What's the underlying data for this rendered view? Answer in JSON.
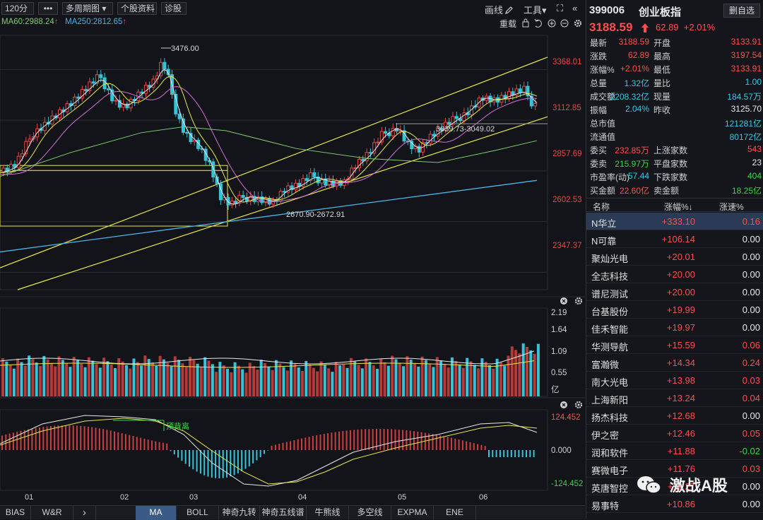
{
  "toolbar": {
    "period": "120分",
    "more": "•••",
    "multi": "多周期图",
    "dropdown": "▾",
    "info": "个股资料",
    "diag": "诊股",
    "draw": "画线",
    "tools": "工具",
    "tools_arrow": "▾",
    "expand": "⛶",
    "collapse": "«",
    "overlay": "重载"
  },
  "ma": {
    "ma60": "MA60:2988.24",
    "ma250": "MA250:2812.65",
    "arrow": "↑"
  },
  "chart_data": {
    "type": "candlestick",
    "price_axis": [
      "3368.01",
      "3112.85",
      "2857.69",
      "2602.53",
      "2347.37"
    ],
    "annotations": {
      "high": "3476.00",
      "low_zone": "2670.90-2672.91",
      "mid_zone": "3039.73-3049.02"
    },
    "volume_axis": [
      "2.19",
      "1.64",
      "1.09",
      "0.55",
      "亿"
    ],
    "macd_axis": [
      "124.452",
      "0.000",
      "-124.452"
    ],
    "macd_label": "顶背离",
    "months": [
      "01",
      "02",
      "03",
      "04",
      "05",
      "06"
    ]
  },
  "icons": {
    "lock": "lock-icon",
    "undo": "undo-icon",
    "plus": "plus-icon",
    "minus": "minus-icon",
    "gear": "gear-icon",
    "close": "close-icon"
  },
  "bottom_tabs": [
    "BIAS",
    "W&R",
    "›",
    "MA",
    "BOLL",
    "神奇九转",
    "神奇五线谱",
    "牛熊线",
    "多空线",
    "EXPMA",
    "ENE"
  ],
  "quote": {
    "code": "399006",
    "name": "创业板指",
    "remove": "删自选",
    "price": "3188.59",
    "change": "62.89",
    "pct": "+2.01%",
    "rows": [
      [
        "最新",
        "3188.59",
        "red",
        "开盘",
        "3133.91",
        "red"
      ],
      [
        "涨跌",
        "62.89",
        "red",
        "最高",
        "3197.54",
        "red"
      ],
      [
        "涨幅%",
        "+2.01%",
        "red",
        "最低",
        "3133.91",
        "red"
      ],
      [
        "总量",
        "1.32亿",
        "cyan",
        "量比",
        "1.00",
        "cyan"
      ],
      [
        "成交额",
        "2208.32亿",
        "cyan",
        "现量",
        "184.57万",
        "cyan"
      ],
      [
        "振幅",
        "2.04%",
        "cyan",
        "昨收",
        "3125.70",
        "white"
      ],
      [
        "总市值",
        "",
        "white",
        "",
        "121281亿",
        "cyan"
      ],
      [
        "流通值",
        "",
        "white",
        "",
        "80172亿",
        "cyan"
      ],
      [
        "委买",
        "232.85万",
        "red",
        "上涨家数",
        "543",
        "red"
      ],
      [
        "委卖",
        "215.97万",
        "green",
        "平盘家数",
        "23",
        "white"
      ],
      [
        "市盈率(动)",
        "57.44",
        "cyan",
        "下跌家数",
        "404",
        "green"
      ],
      [
        "买金额",
        "22.60亿",
        "red",
        "卖金额",
        "18.25亿",
        "green"
      ]
    ]
  },
  "list": {
    "headers": [
      "名称",
      "涨幅%↓",
      "涨速%"
    ],
    "rows": [
      [
        "N华立",
        "+333.10",
        "0.16",
        "red"
      ],
      [
        "N可靠",
        "+106.14",
        "0.00",
        "white"
      ],
      [
        "聚灿光电",
        "+20.01",
        "0.00",
        "white"
      ],
      [
        "全志科技",
        "+20.00",
        "0.00",
        "white"
      ],
      [
        "谱尼测试",
        "+20.00",
        "0.00",
        "white"
      ],
      [
        "台基股份",
        "+19.99",
        "0.00",
        "white"
      ],
      [
        "佳禾智能",
        "+19.97",
        "0.00",
        "white"
      ],
      [
        "华测导航",
        "+15.59",
        "0.06",
        "red"
      ],
      [
        "富瀚微",
        "+14.34",
        "0.24",
        "red"
      ],
      [
        "南大光电",
        "+13.98",
        "0.03",
        "red"
      ],
      [
        "上海新阳",
        "+13.24",
        "0.04",
        "red"
      ],
      [
        "扬杰科技",
        "+12.68",
        "0.00",
        "white"
      ],
      [
        "伊之密",
        "+12.46",
        "0.05",
        "red"
      ],
      [
        "润和软件",
        "+11.88",
        "-0.02",
        "green"
      ],
      [
        "赛微电子",
        "+11.76",
        "0.03",
        "red"
      ],
      [
        "英唐智控",
        "+11.27",
        "0.00",
        "white"
      ],
      [
        "易事特",
        "+10.86",
        "0.00",
        "white"
      ]
    ]
  },
  "watermark": "激战A股",
  "colors": {
    "up": "#e84545",
    "down": "#36c3d8",
    "ma5": "#e8e8e8",
    "ma10": "#e8e84a",
    "ma20": "#d36fd3",
    "ma60": "#7ccd6e",
    "ma250": "#4ab3e8",
    "channel": "#e8e84a"
  }
}
